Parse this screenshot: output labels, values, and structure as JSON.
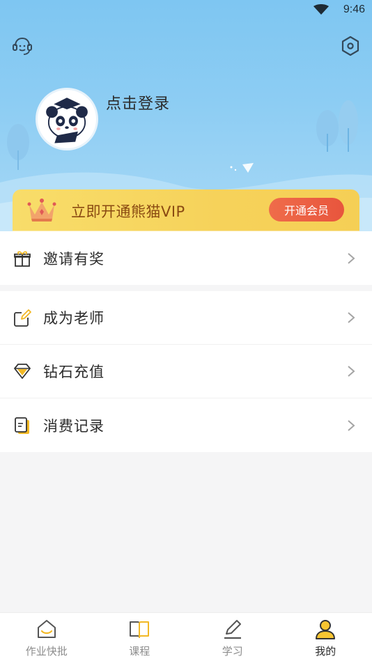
{
  "status_bar": {
    "time": "9:46"
  },
  "header": {
    "login_text": "点击登录",
    "icons": {
      "support": "headset-support-icon",
      "settings": "hexagon-settings-icon"
    }
  },
  "vip": {
    "title": "立即开通熊猫VIP",
    "button_label": "开通会员",
    "colors": {
      "banner": "#f6d25a",
      "button": "#e8553d",
      "text": "#8a4a12"
    }
  },
  "menu": {
    "group1": [
      {
        "label": "邀请有奖",
        "icon": "gift-icon"
      }
    ],
    "group2": [
      {
        "label": "成为老师",
        "icon": "edit-icon"
      },
      {
        "label": "钻石充值",
        "icon": "diamond-icon"
      },
      {
        "label": "消费记录",
        "icon": "record-icon"
      }
    ]
  },
  "nav": {
    "items": [
      {
        "label": "作业快批",
        "icon": "home-icon"
      },
      {
        "label": "课程",
        "icon": "book-icon"
      },
      {
        "label": "学习",
        "icon": "pen-icon"
      },
      {
        "label": "我的",
        "icon": "user-icon",
        "active": true
      }
    ],
    "accent": "#f7c531"
  }
}
